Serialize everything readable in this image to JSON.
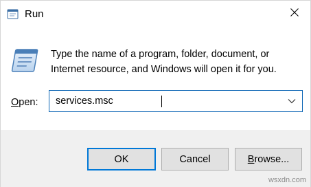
{
  "window": {
    "title": "Run",
    "close_icon": "close-icon",
    "app_icon": "run-icon"
  },
  "content": {
    "message": "Type the name of a program, folder, document, or Internet resource, and Windows will open it for you.",
    "open_label_accel": "O",
    "open_label_rest": "pen:",
    "open_value": "services.msc",
    "dropdown_icon": "chevron-down-icon"
  },
  "buttons": {
    "ok": "OK",
    "cancel": "Cancel",
    "browse_accel": "B",
    "browse_rest": "rowse..."
  },
  "watermark": "wsxdn.com",
  "colors": {
    "focus_border": "#0078d7",
    "footer_bg": "#f0f0f0",
    "button_bg": "#e1e1e1"
  }
}
